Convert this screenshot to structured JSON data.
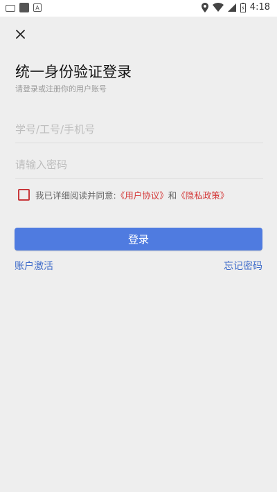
{
  "status_bar": {
    "time": "4:18",
    "a_icon_letter": "A"
  },
  "page": {
    "title": "统一身份验证登录",
    "subtitle": "请登录或注册你的用户账号"
  },
  "form": {
    "account_placeholder": "学号/工号/手机号",
    "password_placeholder": "请输入密码",
    "agree_text": "我已详细阅读并同意:",
    "user_agreement": "《用户协议》",
    "and_text": "和",
    "privacy_policy": "《隐私政策》",
    "login_label": "登录"
  },
  "links": {
    "activate_account": "账户激活",
    "forgot_password": "忘记密码"
  },
  "colors": {
    "primary_button": "#4f7be0",
    "link_blue": "#3e6bc9",
    "link_red": "#d43a3a",
    "background": "#eeeeee"
  },
  "icons": [
    "keyboard-icon",
    "notification-icon",
    "a-icon",
    "location-icon",
    "wifi-icon",
    "signal-icon",
    "battery-icon",
    "close-icon"
  ]
}
